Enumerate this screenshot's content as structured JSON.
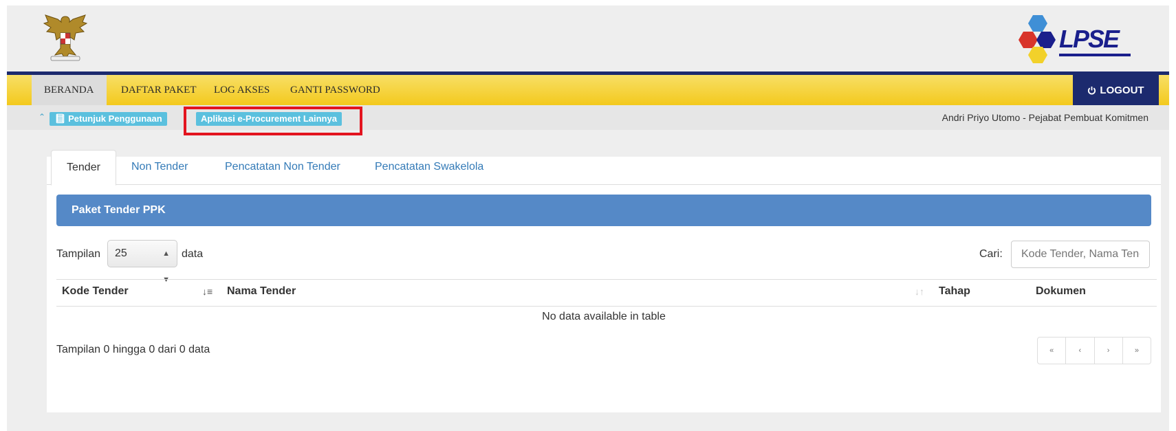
{
  "header": {
    "logo_text": "LPSE"
  },
  "nav": {
    "items": [
      "BERANDA",
      "DAFTAR PAKET",
      "LOG AKSES",
      "GANTI PASSWORD"
    ],
    "logout": "LOGOUT"
  },
  "subbar": {
    "guide_button": "Petunjuk Penggunaan",
    "apps_button": "Aplikasi e-Procurement Lainnya",
    "user": "Andri Priyo Utomo - Pejabat Pembuat Komitmen"
  },
  "tabs": [
    "Tender",
    "Non Tender",
    "Pencatatan Non Tender",
    "Pencatatan Swakelola"
  ],
  "panel": {
    "title": "Paket Tender PPK"
  },
  "controls": {
    "show_label": "Tampilan",
    "page_size": "25",
    "data_label": "data",
    "search_label": "Cari:",
    "search_placeholder": "Kode Tender, Nama Tender"
  },
  "table": {
    "columns": [
      "Kode Tender",
      "Nama Tender",
      "Tahap",
      "Dokumen"
    ],
    "empty_text": "No data available in table"
  },
  "footer": {
    "info": "Tampilan 0 hingga 0 dari 0 data",
    "pager": [
      "«",
      "‹",
      "›",
      "»"
    ]
  },
  "colors": {
    "navy": "#1c2a6e",
    "yellow": "#f3c91d",
    "panel_blue": "#5589c7",
    "highlight": "#e3141f"
  }
}
